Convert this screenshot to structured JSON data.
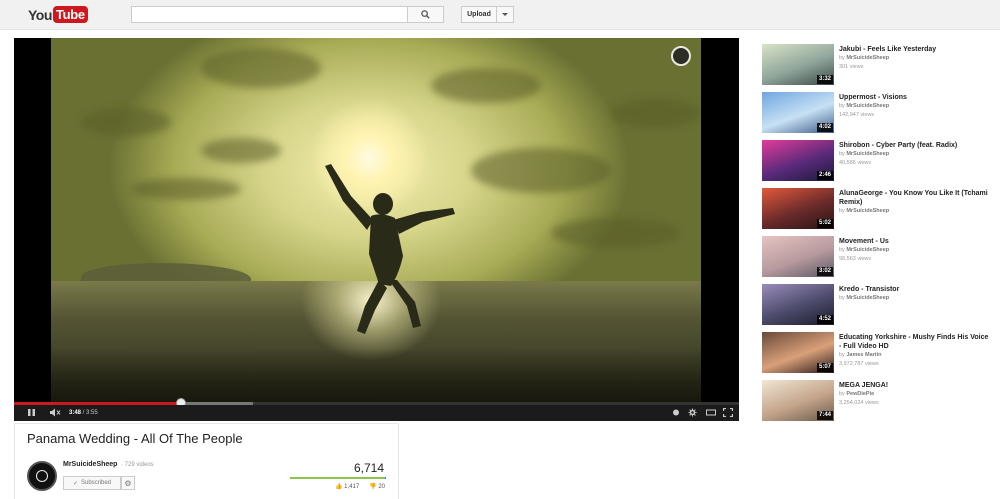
{
  "header": {
    "logo_you": "You",
    "logo_tube": "Tube",
    "search_placeholder": "",
    "upload_label": "Upload"
  },
  "player": {
    "current_time": "3:48",
    "separator": " / ",
    "duration": "3:55",
    "played_fraction": 0.23,
    "loaded_fraction": 0.33
  },
  "video": {
    "title": "Panama Wedding - All Of The People",
    "channel": "MrSuicideSheep",
    "channel_videos": "· 729 videos",
    "subscribe_label": "Subscribed",
    "view_count": "6,714",
    "likes": "1,417",
    "dislikes": "20",
    "like_fraction": 0.986
  },
  "colors": {
    "accent_red": "#cc181e",
    "like_green": "#8ec44b",
    "dislike_blue": "#2793e6"
  },
  "related": [
    {
      "title": "Jakubi - Feels Like Yesterday",
      "by": "by",
      "channel": "MrSuicideSheep",
      "views": "301 views",
      "duration": "3:32",
      "thumb": [
        "#d9e3c7",
        "#8fa59a",
        "#3a4a46"
      ]
    },
    {
      "title": "Uppermost - Visions",
      "by": "by",
      "channel": "MrSuicideSheep",
      "views": "142,947 views",
      "duration": "4:02",
      "thumb": [
        "#6ea6e0",
        "#c7e0f4",
        "#3d5a88"
      ]
    },
    {
      "title": "Shirobon - Cyber Party (feat. Radix)",
      "by": "by",
      "channel": "MrSuicideSheep",
      "views": "40,586 views",
      "duration": "2:46",
      "thumb": [
        "#e43c9a",
        "#5a2a7a",
        "#1a1a3a"
      ]
    },
    {
      "title": "AlunaGeorge - You Know You Like It (Tchami Remix)",
      "by": "by",
      "channel": "MrSuicideSheep",
      "views": "",
      "duration": "5:02",
      "thumb": [
        "#e25a3c",
        "#6a2a2a",
        "#2a1414"
      ]
    },
    {
      "title": "Movement - Us",
      "by": "by",
      "channel": "MrSuicideSheep",
      "views": "98,563 views",
      "duration": "3:02",
      "thumb": [
        "#e6c4c0",
        "#b79a9e",
        "#5c5864"
      ]
    },
    {
      "title": "Kredo - Transistor",
      "by": "by",
      "channel": "MrSuicideSheep",
      "views": "",
      "duration": "4:52",
      "thumb": [
        "#9a8cba",
        "#4a4a6a",
        "#1c1c2a"
      ]
    },
    {
      "title": "Educating Yorkshire - Mushy Finds His Voice - Full Video HD",
      "by": "by",
      "channel": "James Martin",
      "views": "3,972,787 views",
      "duration": "5:07",
      "thumb": [
        "#6a4a3a",
        "#d9a07a",
        "#2a1a1a"
      ]
    },
    {
      "title": "MEGA JENGA!",
      "by": "by",
      "channel": "PewDiePie",
      "views": "3,254,024 views",
      "duration": "7:44",
      "thumb": [
        "#f0e6d4",
        "#c4a48a",
        "#6a5a4a"
      ]
    }
  ]
}
